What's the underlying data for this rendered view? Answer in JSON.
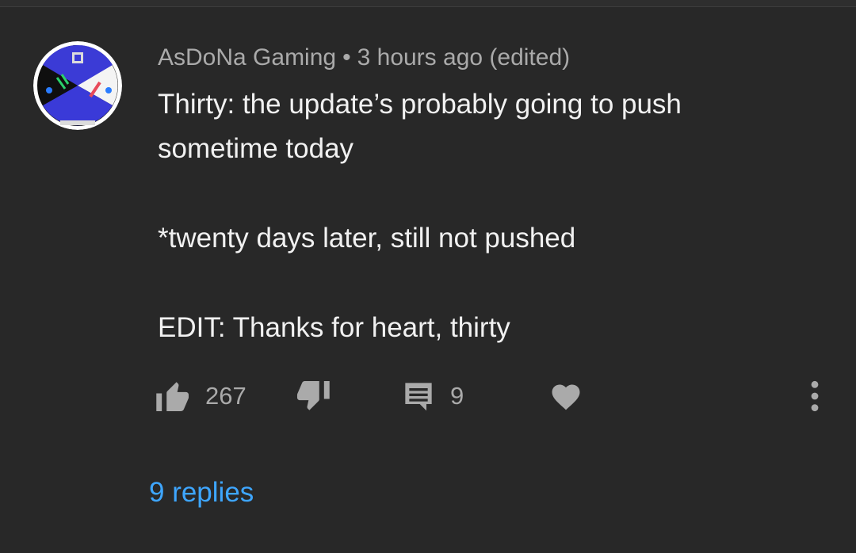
{
  "comment": {
    "author": "AsDoNa Gaming",
    "separator": "•",
    "time": "3 hours ago (edited)",
    "lines": {
      "line1": "Thirty: the update’s probably going to push",
      "line2": "sometime today",
      "line3": "*twenty days later, still not pushed",
      "line4": "EDIT: Thanks for heart, thirty"
    },
    "avatar_icon": "avatar-logo-icon"
  },
  "actions": {
    "like_count": "267",
    "like_icon": "thumbs-up-icon",
    "dislike_icon": "thumbs-down-icon",
    "reply_count": "9",
    "reply_icon": "comment-icon",
    "heart_icon": "heart-icon",
    "more_icon": "more-vertical-icon"
  },
  "replies_label": "9 replies",
  "colors": {
    "background": "#282828",
    "text": "#f1f1f1",
    "muted": "#aaaaaa",
    "link": "#3ea6ff"
  }
}
